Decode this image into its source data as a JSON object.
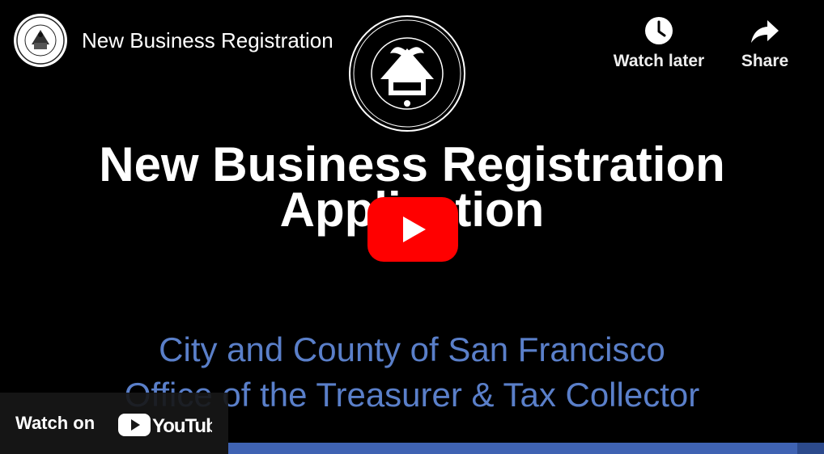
{
  "video": {
    "title": "New Business Registration",
    "channel_avatar_icon": "sf-treasurer-seal-icon"
  },
  "actions": {
    "watch_later_label": "Watch later",
    "watch_later_icon": "clock-icon",
    "share_label": "Share",
    "share_icon": "share-arrow-icon"
  },
  "slide": {
    "seal_icon": "treasurer-seal-icon",
    "heading_line1": "New Business Registration",
    "heading_line2": "Application",
    "subtitle_line1": "City and County of San Francisco",
    "subtitle_line2": "Office of the Treasurer & Tax Collector"
  },
  "play": {
    "icon": "youtube-play-icon"
  },
  "watch_on": {
    "label": "Watch on",
    "brand": "YouTube"
  },
  "colors": {
    "subtitle": "#5a7fc9",
    "play_red": "#ff0000",
    "bar": "#3f63b3"
  }
}
